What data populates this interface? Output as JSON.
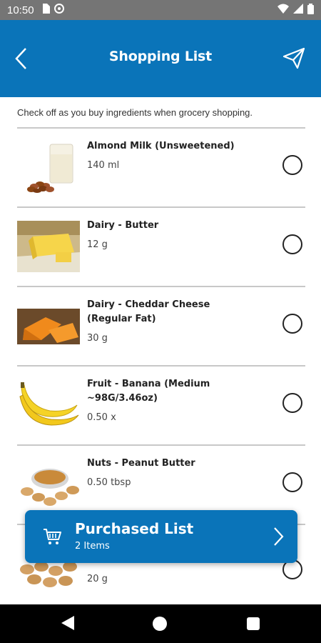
{
  "status_bar": {
    "time": "10:50"
  },
  "header": {
    "title": "Shopping List"
  },
  "instruction": "Check off as you buy ingredients when grocery shopping.",
  "items": [
    {
      "name": "Almond Milk (Unsweetened)",
      "qty": "140 ml"
    },
    {
      "name": "Dairy - Butter",
      "qty": "12 g"
    },
    {
      "name": "Dairy - Cheddar Cheese (Regular Fat)",
      "qty": "30 g"
    },
    {
      "name": "Fruit - Banana (Medium ~98G/3.46oz)",
      "qty": "0.50 x"
    },
    {
      "name": "Nuts - Peanut Butter",
      "qty": "0.50 tbsp"
    },
    {
      "name": "",
      "qty": "20 g"
    }
  ],
  "purchased": {
    "title": "Purchased List",
    "subtitle": "2 Items"
  },
  "colors": {
    "brand": "#0a74b9",
    "status_bar": "#757575"
  }
}
